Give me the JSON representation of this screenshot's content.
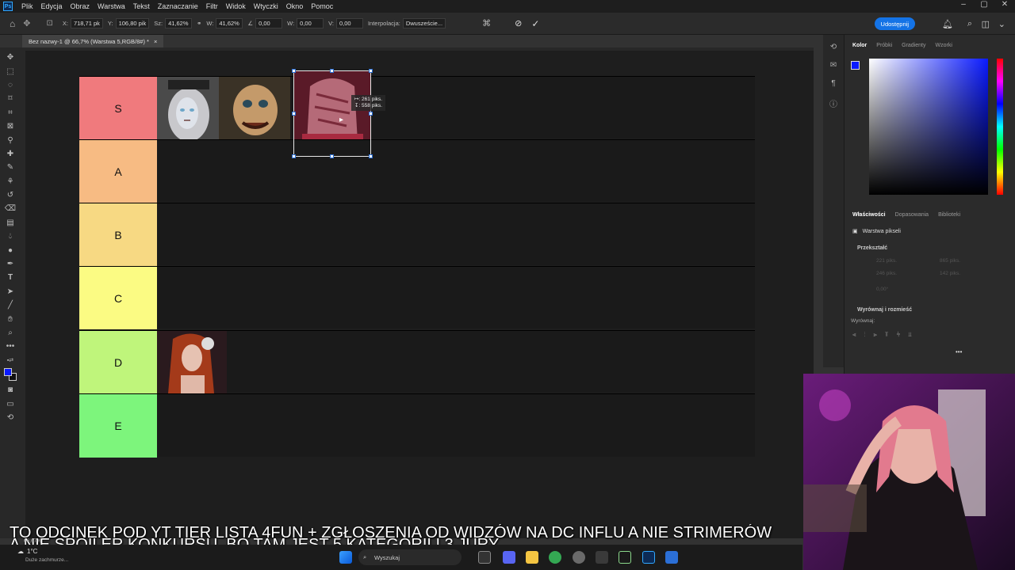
{
  "app": {
    "logo": "Ps",
    "menu": [
      "Plik",
      "Edycja",
      "Obraz",
      "Warstwa",
      "Tekst",
      "Zaznaczanie",
      "Filtr",
      "Widok",
      "Wtyczki",
      "Okno",
      "Pomoc"
    ],
    "window_controls": [
      "–",
      "▢",
      "✕"
    ]
  },
  "options_bar": {
    "x_label": "X:",
    "x_value": "718,71 pk",
    "y_label": "Y:",
    "y_value": "106,80 pik",
    "s_label": "Sz:",
    "s_value": "41,62%",
    "w_label": "W:",
    "w_value": "41,62%",
    "angle_value": "0,00",
    "h_label": "W:",
    "h_value": "0,00",
    "v_label": "V:",
    "v_value": "0,00",
    "interp_label": "Interpolacja:",
    "interp_value": "Dwuszeście...",
    "share_label": "Udostępnij"
  },
  "document_tab": {
    "title": "Bez nazwy-1 @ 66,7% (Warstwa 5,RGB/8#) *",
    "close": "×"
  },
  "tiers": [
    {
      "label": "S",
      "color": "#f07a7d"
    },
    {
      "label": "A",
      "color": "#f7bb83"
    },
    {
      "label": "B",
      "color": "#f7d983"
    },
    {
      "label": "C",
      "color": "#fbfb83"
    },
    {
      "label": "D",
      "color": "#bff57b"
    },
    {
      "label": "E",
      "color": "#7df57c"
    }
  ],
  "transform_tooltip": {
    "line1": "↦: 261 piks.",
    "line2": "↧: 558 piks."
  },
  "color_panel": {
    "tabs": [
      "Kolor",
      "Próbki",
      "Gradienty",
      "Wzorki"
    ],
    "active_tab": "Kolor",
    "foreground": "#0a1aff",
    "background": "#ffffff",
    "hue": "#0a1aff"
  },
  "properties_panel": {
    "tabs": [
      "Właściwości",
      "Dopasowania",
      "Biblioteki"
    ],
    "layer_type": "Warstwa pikseli",
    "transform_section": "Przekształć",
    "w_value": "221 piks.",
    "x_value": "865 piks.",
    "h_value": "246 piks.",
    "y_value": "142 piks.",
    "angle_value": "0,00°",
    "align_section": "Wyrównaj i rozmieść",
    "align_label": "Wyrównaj:",
    "more": "•••"
  },
  "status_bar": {
    "zoom": "66,67%",
    "note": "Duże zachmurze..."
  },
  "caption": {
    "line1": "TO ODCINEK POD YT TIER LISTA 4FUN + ZGŁOSZENIA OD WIDZÓW NA DC INFLU A NIE STRIMERÓW",
    "line2": "A NIE SPOILER KONKURSU, BO TAM JEST 5 KATEGORII I 3 JURY"
  },
  "taskbar": {
    "search_placeholder": "Wyszukaj",
    "weather": "1°C"
  }
}
